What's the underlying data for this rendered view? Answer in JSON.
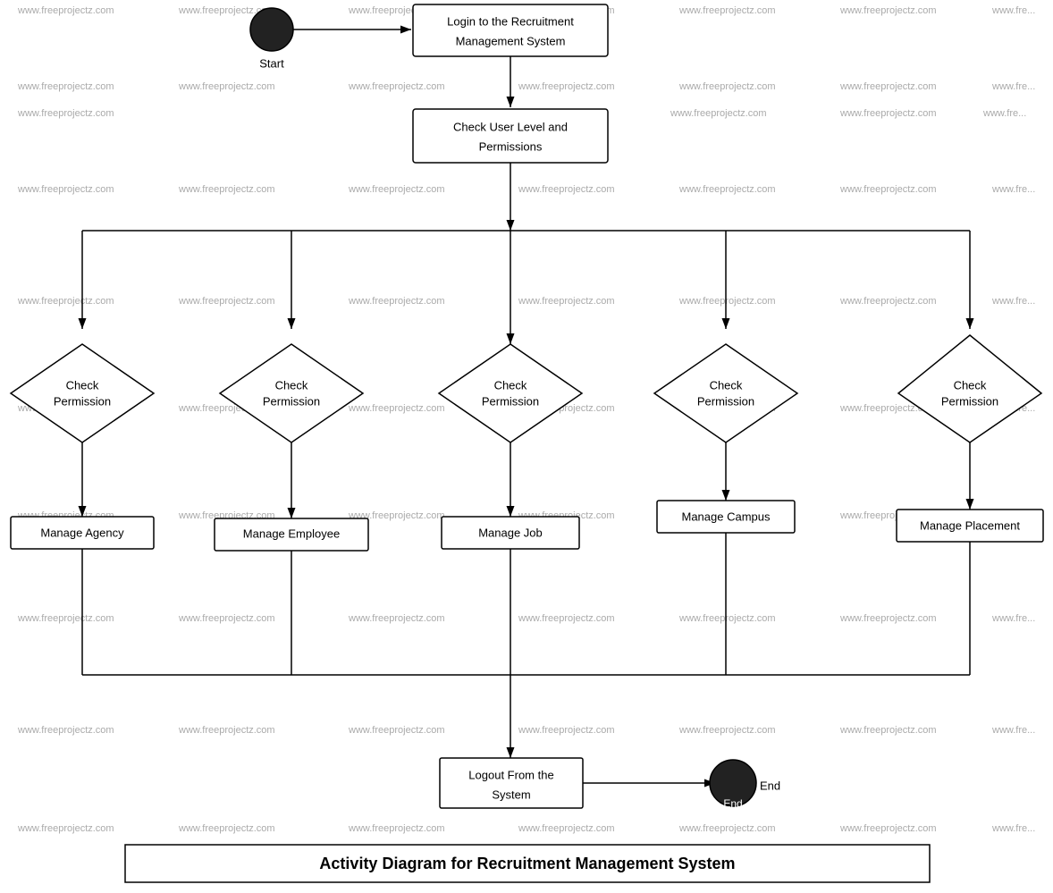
{
  "diagram": {
    "title": "Activity Diagram for Recruitment Management System",
    "watermark": "www.freeprojectz.com",
    "nodes": {
      "start": {
        "label": "Start",
        "type": "circle"
      },
      "login": {
        "label": "Login to the Recruitment\nManagement System",
        "type": "box"
      },
      "checkLevel": {
        "label": "Check User Level and\nPermissions",
        "type": "box"
      },
      "checkPerm1": {
        "label": "Check\nPermission",
        "type": "diamond"
      },
      "checkPerm2": {
        "label": "Check\nPermission",
        "type": "diamond"
      },
      "checkPerm3": {
        "label": "Check\nPermission",
        "type": "diamond"
      },
      "checkPerm4": {
        "label": "Check\nPermission",
        "type": "diamond"
      },
      "checkPerm5": {
        "label": "Check\nPermission",
        "type": "diamond"
      },
      "manageAgency": {
        "label": "Manage Agency",
        "type": "box"
      },
      "manageEmployee": {
        "label": "Manage Employee",
        "type": "box"
      },
      "manageJob": {
        "label": "Manage Job",
        "type": "box"
      },
      "manageCampus": {
        "label": "Manage Campus",
        "type": "box"
      },
      "managePlacement": {
        "label": "Manage Placement",
        "type": "box"
      },
      "logout": {
        "label": "Logout From the\nSystem",
        "type": "box"
      },
      "end": {
        "label": "End",
        "type": "circle"
      }
    }
  }
}
